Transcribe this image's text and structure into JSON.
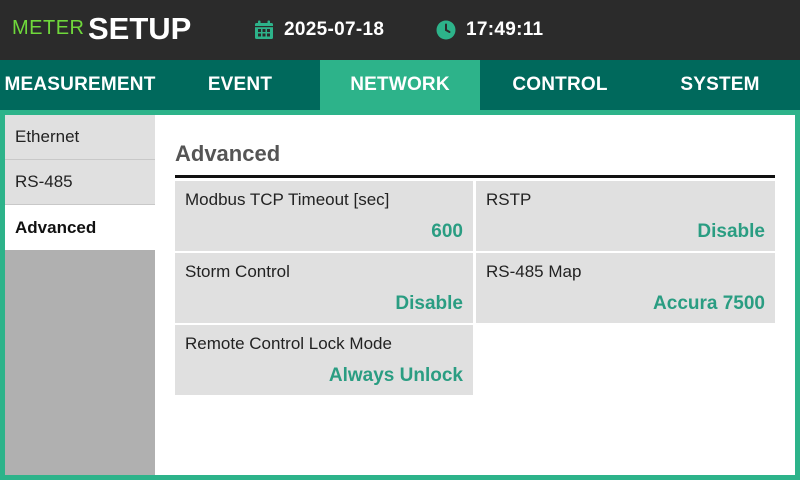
{
  "header": {
    "brand_sub": "METER",
    "brand_main": "SETUP",
    "date": "2025-07-18",
    "time": "17:49:11",
    "date_icon": "calendar-icon",
    "time_icon": "clock-icon"
  },
  "tabs": [
    {
      "label": "MEASUREMENT",
      "active": false
    },
    {
      "label": "EVENT",
      "active": false
    },
    {
      "label": "NETWORK",
      "active": true
    },
    {
      "label": "CONTROL",
      "active": false
    },
    {
      "label": "SYSTEM",
      "active": false
    }
  ],
  "sidebar": {
    "items": [
      {
        "label": "Ethernet",
        "active": false
      },
      {
        "label": "RS-485",
        "active": false
      },
      {
        "label": "Advanced",
        "active": true
      }
    ]
  },
  "content": {
    "title": "Advanced",
    "settings": [
      {
        "label": "Modbus TCP Timeout [sec]",
        "value": "600"
      },
      {
        "label": "RSTP",
        "value": "Disable"
      },
      {
        "label": "Storm Control",
        "value": "Disable"
      },
      {
        "label": "RS-485 Map",
        "value": "Accura 7500"
      },
      {
        "label": "Remote Control Lock Mode",
        "value": "Always Unlock"
      }
    ]
  },
  "colors": {
    "accent": "#2db38a",
    "tab_bar": "#00695c",
    "brand_green": "#6fd83b",
    "value_green": "#2a9d82"
  }
}
